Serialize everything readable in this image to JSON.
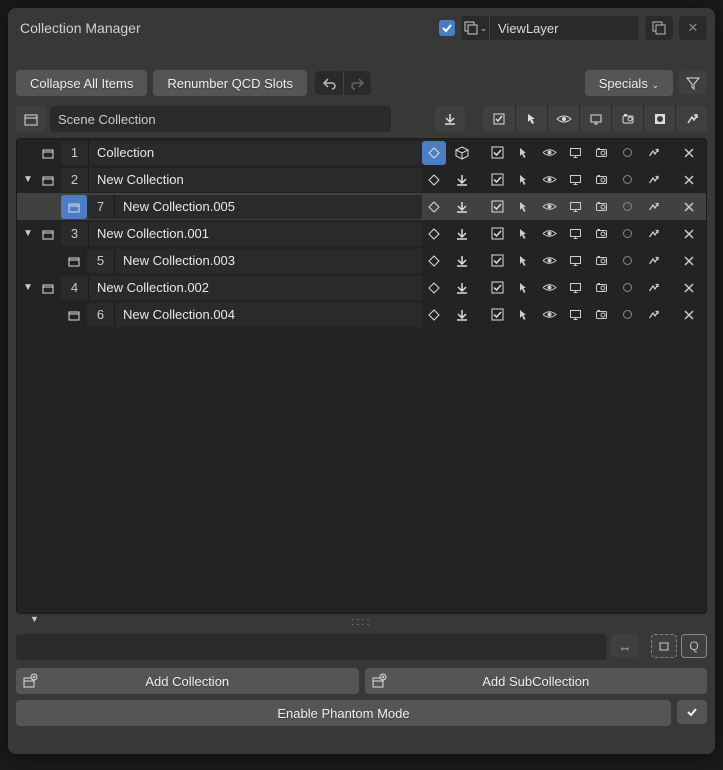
{
  "title": "Collection Manager",
  "viewlayer": "ViewLayer",
  "toolbar": {
    "collapse": "Collapse All Items",
    "renumber": "Renumber QCD Slots",
    "specials": "Specials"
  },
  "scene_collection": "Scene Collection",
  "rows": [
    {
      "indent": 0,
      "expander": "",
      "slot": "1",
      "name": "Collection",
      "active_icon": false,
      "diamond_active": true,
      "first_icon": "cube",
      "selected": false
    },
    {
      "indent": 0,
      "expander": "▼",
      "slot": "2",
      "name": "New Collection",
      "active_icon": false,
      "diamond_active": false,
      "first_icon": "down",
      "selected": false
    },
    {
      "indent": 1,
      "expander": "",
      "slot": "7",
      "name": "New Collection.005",
      "active_icon": true,
      "diamond_active": false,
      "first_icon": "down",
      "selected": true
    },
    {
      "indent": 0,
      "expander": "▼",
      "slot": "3",
      "name": "New Collection.001",
      "active_icon": false,
      "diamond_active": false,
      "first_icon": "down",
      "selected": false
    },
    {
      "indent": 1,
      "expander": "",
      "slot": "5",
      "name": "New Collection.003",
      "active_icon": false,
      "diamond_active": false,
      "first_icon": "down",
      "selected": false
    },
    {
      "indent": 0,
      "expander": "▼",
      "slot": "4",
      "name": "New Collection.002",
      "active_icon": false,
      "diamond_active": false,
      "first_icon": "down",
      "selected": false
    },
    {
      "indent": 1,
      "expander": "",
      "slot": "6",
      "name": "New Collection.004",
      "active_icon": false,
      "diamond_active": false,
      "first_icon": "down",
      "selected": false
    }
  ],
  "buttons": {
    "add_collection": "Add Collection",
    "add_subcollection": "Add SubCollection",
    "phantom": "Enable Phantom Mode"
  },
  "resize_dots": "::::",
  "resize_marker": "▼"
}
